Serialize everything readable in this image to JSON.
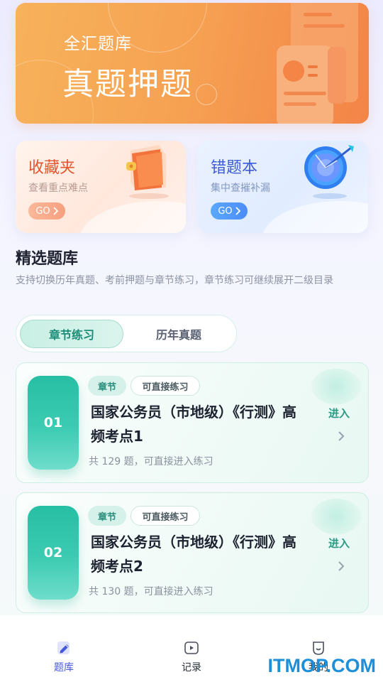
{
  "banner": {
    "subtitle": "全汇题库",
    "title": "真题押题"
  },
  "cards": {
    "favorites": {
      "title": "收藏夹",
      "desc": "查看重点难点",
      "go": "GO",
      "icon": "red-book-icon",
      "accent": "#e2552d"
    },
    "wrong_book": {
      "title": "错题本",
      "desc": "集中查摧补漏",
      "go": "GO",
      "icon": "target-dart-icon",
      "accent": "#3e5bd8"
    }
  },
  "section": {
    "title": "精选题库",
    "desc": "支持切换历年真题、考前押题与章节练习，章节练习可继续展开二级目录"
  },
  "tabs": [
    {
      "label": "章节练习",
      "active": true
    },
    {
      "label": "历年真题",
      "active": false
    }
  ],
  "chapters": [
    {
      "num": "01",
      "tag": "章节",
      "tag2": "可直接练习",
      "title": "国家公务员（市地级）《行测》高频考点1",
      "meta": "共 129 题，可直接进入练习",
      "enter": "进入"
    },
    {
      "num": "02",
      "tag": "章节",
      "tag2": "可直接练习",
      "title": "国家公务员（市地级）《行测》高频考点2",
      "meta": "共 130 题，可直接进入练习",
      "enter": "进入"
    }
  ],
  "nav": [
    {
      "label": "题库",
      "icon": "pen-edit-icon",
      "active": true
    },
    {
      "label": "记录",
      "icon": "play-record-icon",
      "active": false
    },
    {
      "label": "我的",
      "icon": "profile-face-icon",
      "active": false
    }
  ],
  "watermark": "ITMOP.COM",
  "colors": {
    "primary_teal": "#27bfa4",
    "banner_orange": "#f6a353",
    "nav_active": "#4658d8"
  }
}
